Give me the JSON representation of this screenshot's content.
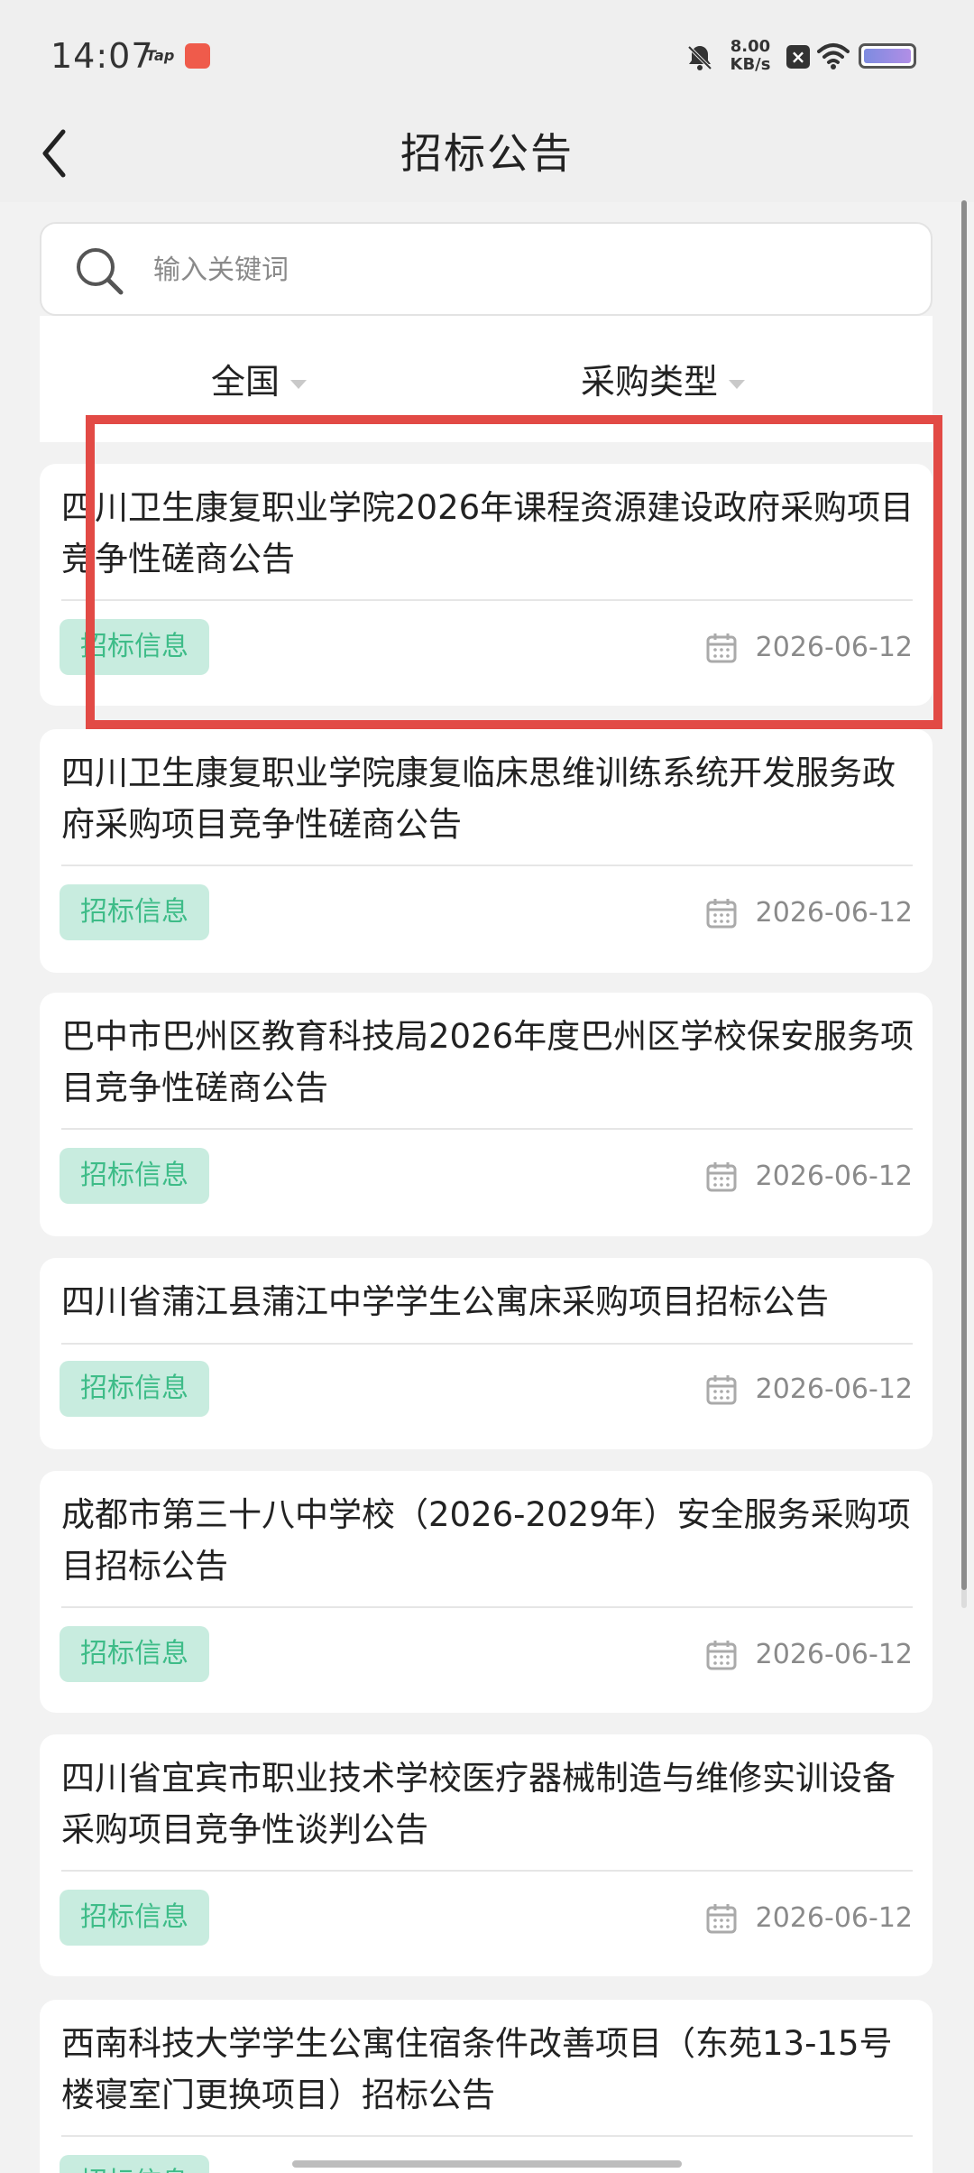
{
  "status_bar": {
    "time": "14:07",
    "tap_label": "Tap",
    "net_speed_value": "8.00",
    "net_speed_unit": "KB/s",
    "battery_level_pct": 100,
    "icons": [
      "bell-off-icon",
      "x-box-icon",
      "wifi-icon",
      "battery-icon"
    ]
  },
  "header": {
    "title": "招标公告"
  },
  "search": {
    "placeholder": "输入关键词",
    "value": ""
  },
  "filters": {
    "region": "全国",
    "type": "采购类型"
  },
  "list": [
    {
      "title": "四川卫生康复职业学院2026年课程资源建设政府采购项目竞争性磋商公告",
      "tag": "招标信息",
      "date": "2026-06-12"
    },
    {
      "title": "四川卫生康复职业学院康复临床思维训练系统开发服务政府采购项目竞争性磋商公告",
      "tag": "招标信息",
      "date": "2026-06-12"
    },
    {
      "title": "巴中市巴州区教育科技局2026年度巴州区学校保安服务项目竞争性磋商公告",
      "tag": "招标信息",
      "date": "2026-06-12"
    },
    {
      "title": "四川省蒲江县蒲江中学学生公寓床采购项目招标公告",
      "tag": "招标信息",
      "date": "2026-06-12"
    },
    {
      "title": "成都市第三十八中学校（2026-2029年）安全服务采购项目招标公告",
      "tag": "招标信息",
      "date": "2026-06-12"
    },
    {
      "title": "四川省宜宾市职业技术学校医疗器械制造与维修实训设备采购项目竞争性谈判公告",
      "tag": "招标信息",
      "date": "2026-06-12"
    },
    {
      "title": "西南科技大学学生公寓住宿条件改善项目（东苑13-15号楼寝室门更换项目）招标公告",
      "tag": "招标信息",
      "date": ""
    }
  ],
  "colors": {
    "highlight": "#e24a45",
    "tag_bg": "#c8ecdf",
    "tag_text": "#3ebc88"
  }
}
